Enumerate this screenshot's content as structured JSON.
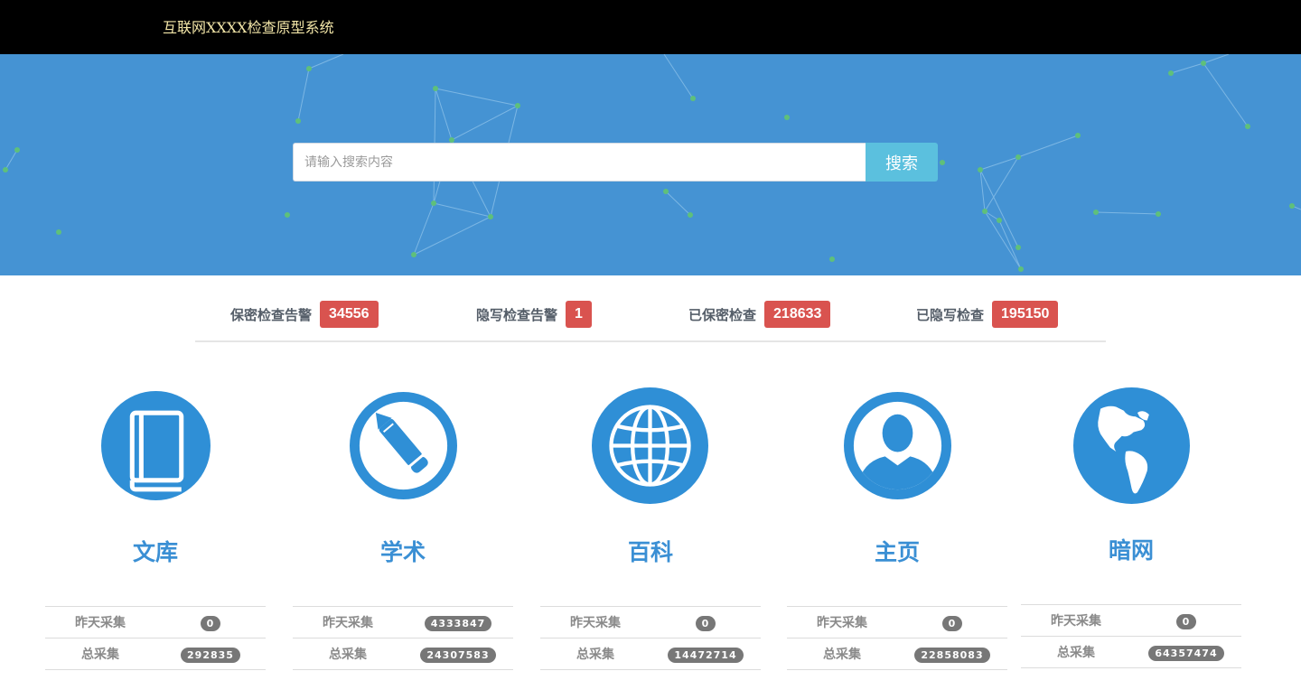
{
  "app": {
    "title": "互联网XXXX检查原型系统"
  },
  "search": {
    "placeholder": "请输入搜索内容",
    "button_label": "搜索"
  },
  "stats": [
    {
      "label": "保密检查告警",
      "value": "34556"
    },
    {
      "label": "隐写检查告警",
      "value": "1"
    },
    {
      "label": "已保密检查",
      "value": "218633"
    },
    {
      "label": "已隐写检查",
      "value": "195150"
    }
  ],
  "categories": [
    {
      "title": "文库",
      "icon": "book-icon",
      "yesterday_label": "昨天采集",
      "yesterday": "0",
      "total_label": "总采集",
      "total": "292835"
    },
    {
      "title": "学术",
      "icon": "pencil-icon",
      "yesterday_label": "昨天采集",
      "yesterday": "4333847",
      "total_label": "总采集",
      "total": "24307583"
    },
    {
      "title": "百科",
      "icon": "globe-icon",
      "yesterday_label": "昨天采集",
      "yesterday": "0",
      "total_label": "总采集",
      "total": "14472714"
    },
    {
      "title": "主页",
      "icon": "user-icon",
      "yesterday_label": "昨天采集",
      "yesterday": "0",
      "total_label": "总采集",
      "total": "22858083"
    },
    {
      "title": "暗网",
      "icon": "world-map-icon",
      "yesterday_label": "昨天采集",
      "yesterday": "0",
      "total_label": "总采集",
      "total": "64357474"
    }
  ],
  "colors": {
    "header_bg": "#000000",
    "brand_text": "#f3e6a8",
    "hero_bg": "#4593d3",
    "search_button": "#5bc0de",
    "alert_badge": "#d9534f",
    "category_blue": "#2f8fd6",
    "count_pill": "#777777"
  }
}
